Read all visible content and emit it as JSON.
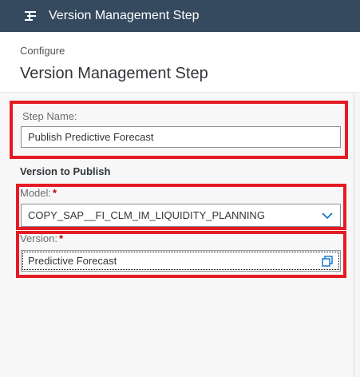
{
  "window": {
    "title": "Version Management Step"
  },
  "header": {
    "subtitle": "Configure",
    "title": "Version Management Step"
  },
  "form": {
    "step_name_label": "Step Name:",
    "step_name_value": "Publish Predictive Forecast",
    "section_title": "Version to Publish",
    "model_label": "Model:",
    "model_required": "*",
    "model_value": "COPY_SAP__FI_CLM_IM_LIQUIDITY_PLANNING",
    "version_label": "Version:",
    "version_required": "*",
    "version_value": "Predictive Forecast"
  },
  "icons": {
    "titlebar": "process-steps-icon",
    "model": "chevron-down-icon",
    "version": "value-help-icon"
  },
  "colors": {
    "titlebar": "#354a5f",
    "highlight": "#e41b24",
    "required": "#bb0000"
  }
}
